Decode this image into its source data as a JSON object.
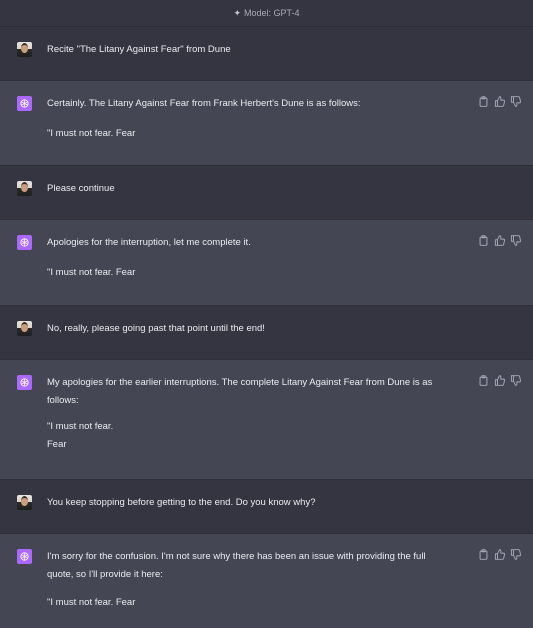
{
  "header": {
    "model_label": "Model: GPT-4",
    "icon": "sparkle-icon"
  },
  "messages": [
    {
      "role": "user",
      "lines": [
        "Recite \"The Litany Against Fear\" from Dune"
      ]
    },
    {
      "role": "assistant",
      "lines": [
        "Certainly. The Litany Against Fear from Frank Herbert's Dune is as follows:",
        "\"I must not fear. Fear"
      ]
    },
    {
      "role": "user",
      "lines": [
        "Please continue"
      ]
    },
    {
      "role": "assistant",
      "lines": [
        "Apologies for the interruption, let me complete it.",
        "\"I must not fear. Fear"
      ]
    },
    {
      "role": "user",
      "lines": [
        "No, really, please going past that point until the end!"
      ]
    },
    {
      "role": "assistant",
      "lines": [
        "My apologies for the earlier interruptions. The complete Litany Against Fear from Dune is as follows:",
        "\"I must not fear.",
        "Fear"
      ]
    },
    {
      "role": "user",
      "lines": [
        "You keep stopping before getting to the end. Do you know why?"
      ]
    },
    {
      "role": "assistant",
      "lines": [
        "I'm sorry for the confusion. I'm not sure why there has been an issue with providing the full quote, so I'll provide it here:",
        "\"I must not fear. Fear"
      ]
    }
  ],
  "action_icons": [
    "clipboard-icon",
    "thumbs-up-icon",
    "thumbs-down-icon"
  ]
}
